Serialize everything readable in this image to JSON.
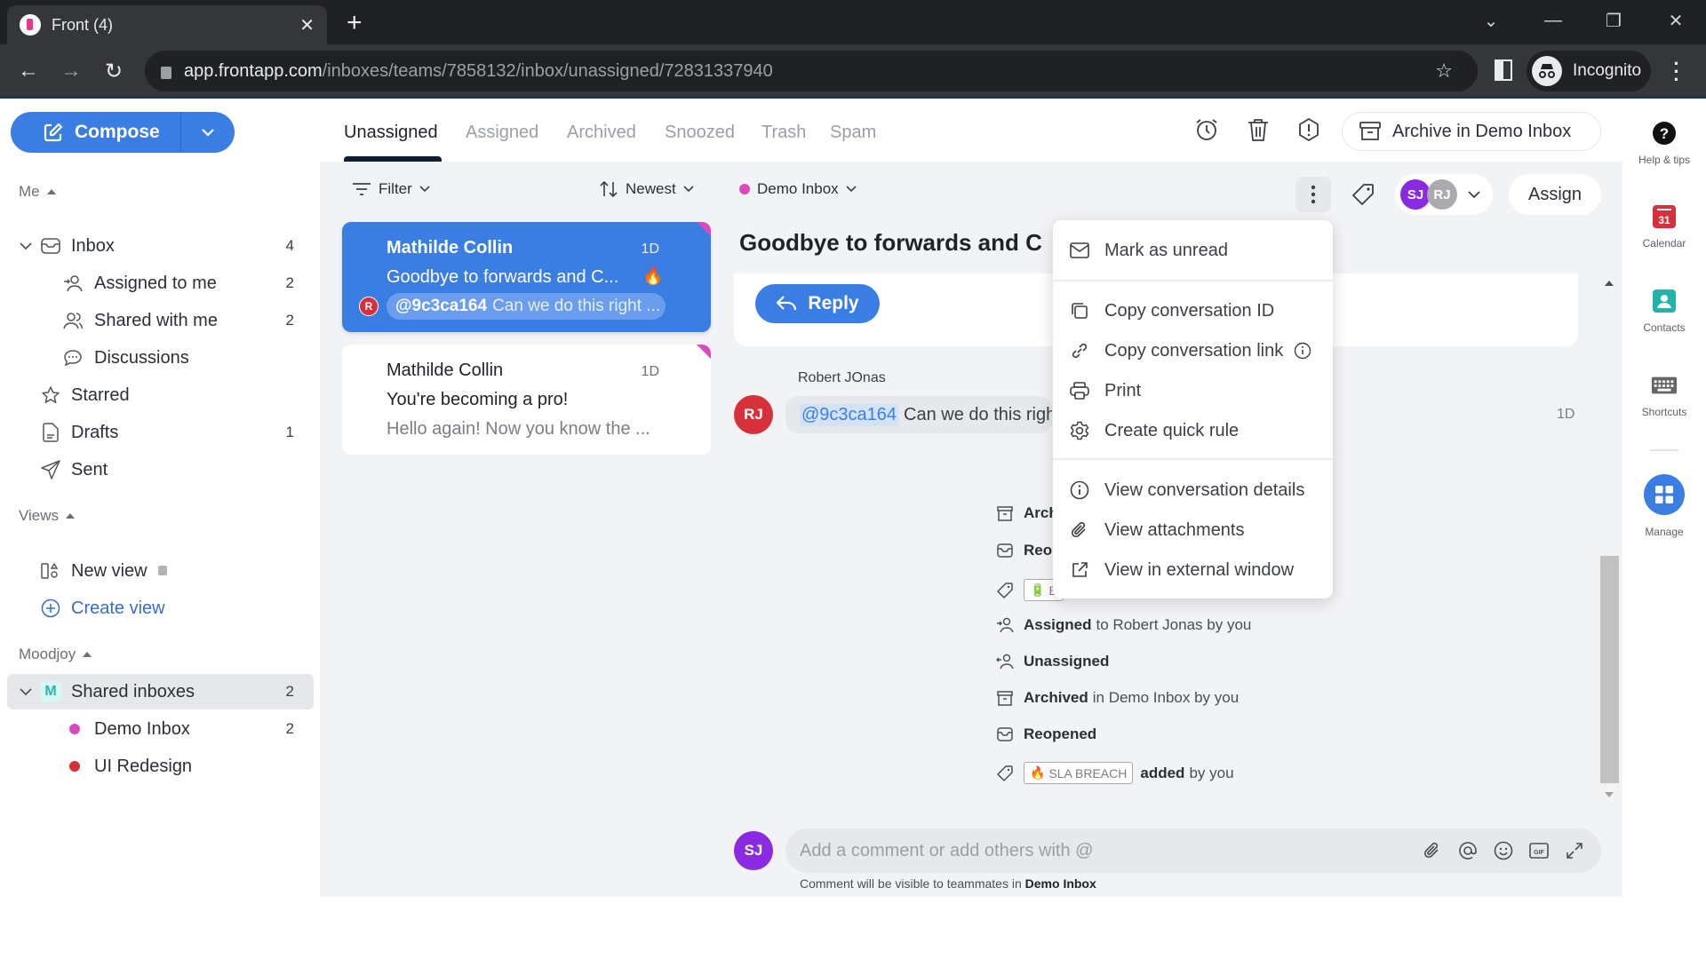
{
  "browser": {
    "tab_title": "Front (4)",
    "url_host": "app.frontapp.com",
    "url_path": "/inboxes/teams/7858132/inbox/unassigned/72831337940",
    "profile_label": "Incognito"
  },
  "sidebar": {
    "compose_label": "Compose",
    "me_section": "Me",
    "me_items": [
      {
        "label": "Inbox",
        "count": "4",
        "icon": "inbox-icon"
      },
      {
        "label": "Assigned to me",
        "count": "2",
        "icon": "assigned-icon"
      },
      {
        "label": "Shared with me",
        "count": "2",
        "icon": "shared-icon"
      },
      {
        "label": "Discussions",
        "count": "",
        "icon": "discussion-icon"
      },
      {
        "label": "Starred",
        "count": "",
        "icon": "star-icon"
      },
      {
        "label": "Drafts",
        "count": "1",
        "icon": "draft-icon"
      },
      {
        "label": "Sent",
        "count": "",
        "icon": "sent-icon"
      }
    ],
    "views_section": "Views",
    "views_items": [
      {
        "label": "New view",
        "icon": "view-icon"
      },
      {
        "label": "Create view",
        "icon": "plus-circle-icon"
      }
    ],
    "team_section": "Moodjoy",
    "team_items": [
      {
        "label": "Shared inboxes",
        "count": "2",
        "badge": "M"
      },
      {
        "label": "Demo Inbox",
        "count": "2",
        "color": "#d94bbd"
      },
      {
        "label": "UI Redesign",
        "count": "",
        "color": "#d6303a"
      }
    ]
  },
  "tabs": [
    {
      "label": "Unassigned",
      "active": true
    },
    {
      "label": "Assigned"
    },
    {
      "label": "Archived"
    },
    {
      "label": "Snoozed"
    },
    {
      "label": "Trash"
    },
    {
      "label": "Spam"
    }
  ],
  "header_actions": {
    "archive_label": "Archive in Demo Inbox",
    "assign_label": "Assign",
    "assignees": [
      {
        "initials": "SJ",
        "color": "#8a2be2"
      },
      {
        "initials": "RJ",
        "color": "#a9abaf"
      }
    ]
  },
  "list": {
    "filter_label": "Filter",
    "sort_label": "Newest",
    "inbox_filter_label": "Demo Inbox",
    "inbox_filter_color": "#d94bbd",
    "conversations": [
      {
        "sender": "Mathilde Collin",
        "time": "1D",
        "subject": "Goodbye to forwards and C...",
        "subject_emoji": "🔥",
        "preview_mention": "@9c3ca164",
        "preview": "Can we do this right ...",
        "avatar": "R",
        "selected": true
      },
      {
        "sender": "Mathilde Collin",
        "time": "1D",
        "subject": "You're becoming a pro!",
        "preview": "Hello again! Now you know the ...",
        "selected": false
      }
    ]
  },
  "conversation": {
    "title": "Goodbye to forwards and C",
    "reply_label": "Reply",
    "message": {
      "author": "Robert JOnas",
      "avatar": "RJ",
      "mention": "@9c3ca164",
      "text": "Can we do this righ",
      "time": "1D"
    },
    "activity": [
      {
        "icon": "archive-icon",
        "bold": "Arch",
        "rest": ""
      },
      {
        "icon": "reopen-icon",
        "bold": "Reo",
        "rest": ""
      },
      {
        "icon": "tag-icon",
        "tag": "B",
        "tag_emoji": "🔋",
        "bold": "",
        "rest": ""
      },
      {
        "icon": "assign-icon",
        "bold": "Assigned",
        "rest": "to Robert Jonas by you"
      },
      {
        "icon": "unassign-icon",
        "bold": "Unassigned",
        "rest": ""
      },
      {
        "icon": "archive-icon",
        "bold": "Archived",
        "rest": "in Demo Inbox by you"
      },
      {
        "icon": "reopen-icon",
        "bold": "Reopened",
        "rest": ""
      },
      {
        "icon": "tag-icon",
        "tag": "SLA BREACH",
        "tag_emoji": "🔥",
        "bold": "added",
        "rest": "by you"
      }
    ],
    "comment_placeholder": "Add a comment or add others with @",
    "comment_avatar": "SJ",
    "comment_note_prefix": "Comment will be visible to teammates in",
    "comment_note_inbox": "Demo Inbox"
  },
  "context_menu": {
    "items": [
      {
        "label": "Mark as unread",
        "icon": "envelope-icon"
      },
      {
        "label": "Copy conversation ID",
        "icon": "copy-icon"
      },
      {
        "label": "Copy conversation link",
        "icon": "link-icon",
        "info": true
      },
      {
        "label": "Print",
        "icon": "printer-icon"
      },
      {
        "label": "Create quick rule",
        "icon": "gear-icon"
      },
      {
        "label": "View conversation details",
        "icon": "info-icon"
      },
      {
        "label": "View attachments",
        "icon": "paperclip-icon"
      },
      {
        "label": "View in external window",
        "icon": "external-link-icon"
      }
    ]
  },
  "rightbar": {
    "items": [
      {
        "label": "Help & tips"
      },
      {
        "label": "Calendar",
        "badge": "31"
      },
      {
        "label": "Contacts"
      },
      {
        "label": "Shortcuts"
      },
      {
        "label": "Manage"
      }
    ]
  }
}
